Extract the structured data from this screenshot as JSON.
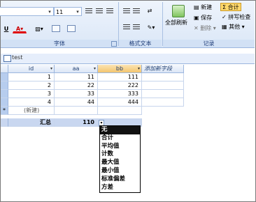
{
  "ribbon": {
    "font_size": "11",
    "groups": {
      "font": "字体",
      "rich_text": "格式文本",
      "records": "记录"
    },
    "records_buttons": {
      "new": "新建",
      "save": "保存",
      "delete": "删除",
      "refresh_all": "全部刷新",
      "totals": "合计",
      "spelling": "拼写检查",
      "more": "其他"
    }
  },
  "tab": {
    "label": "test"
  },
  "table": {
    "columns": [
      "id",
      "aa",
      "bb"
    ],
    "add_field_label": "添加新字段",
    "rows": [
      {
        "id": "1",
        "aa": "11",
        "bb": "111"
      },
      {
        "id": "2",
        "aa": "22",
        "bb": "222"
      },
      {
        "id": "3",
        "aa": "33",
        "bb": "333"
      },
      {
        "id": "4",
        "aa": "44",
        "bb": "444"
      }
    ],
    "new_row_marker": "*",
    "new_row_label": "(新建)",
    "total_label": "汇总",
    "total_aa": "110"
  },
  "totals_dropdown": {
    "selected_index": 0,
    "options": [
      "无",
      "合计",
      "平均值",
      "计数",
      "最大值",
      "最小值",
      "标准偏差",
      "方差"
    ]
  }
}
